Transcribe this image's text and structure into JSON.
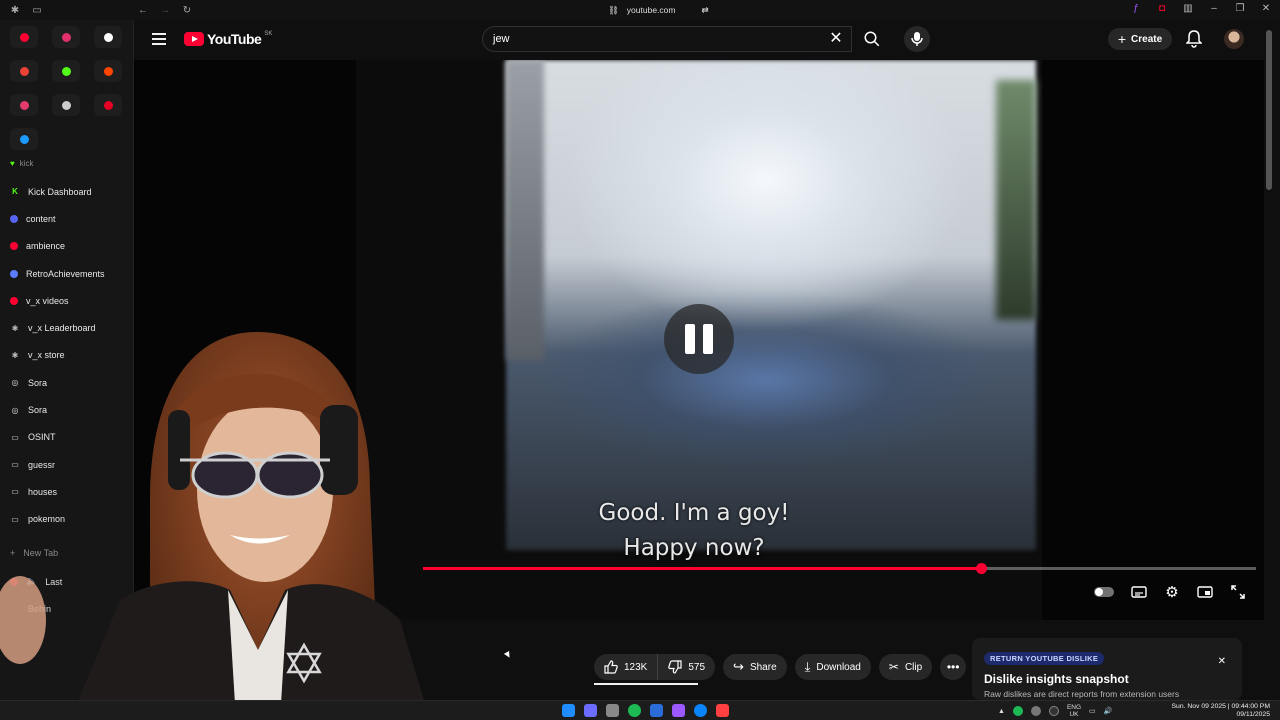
{
  "browser": {
    "url": "youtube.com"
  },
  "sidebar": {
    "pins": [
      {
        "name": "youtube",
        "color": "#ff0033"
      },
      {
        "name": "instagram",
        "color": "#e1306c"
      },
      {
        "name": "x",
        "color": "#ffffff"
      },
      {
        "name": "gmail",
        "color": "#ea4335"
      },
      {
        "name": "kick",
        "color": "#53fc18"
      },
      {
        "name": "reddit",
        "color": "#ff4500"
      },
      {
        "name": "calendar",
        "color": "#e33b6b"
      },
      {
        "name": "threads",
        "color": "#cccccc"
      },
      {
        "name": "pinterest",
        "color": "#e60023"
      },
      {
        "name": "steam",
        "color": "#1b9aff"
      }
    ],
    "section_label": "kick",
    "tabs": [
      {
        "label": "Kick Dashboard",
        "icon": "kick-icon",
        "color": "#53fc18"
      },
      {
        "label": "content",
        "icon": "discord-icon",
        "color": "#5865f2"
      },
      {
        "label": "ambience",
        "icon": "youtube-icon",
        "color": "#ff0033"
      },
      {
        "label": "RetroAchievements",
        "icon": "retro-icon",
        "color": "#5b7cff"
      },
      {
        "label": "v_x videos",
        "icon": "youtube-icon",
        "color": "#ff0033"
      },
      {
        "label": "v_x Leaderboard",
        "icon": "vx-icon",
        "color": "#bbbbbb"
      },
      {
        "label": "v_x store",
        "icon": "vx-icon",
        "color": "#bbbbbb"
      },
      {
        "label": "Sora",
        "icon": "sora-icon",
        "color": "#dddddd"
      },
      {
        "label": "Sora",
        "icon": "sora-icon",
        "color": "#dddddd"
      },
      {
        "label": "OSINT",
        "icon": "folder-icon",
        "color": "#dddddd"
      },
      {
        "label": "guessr",
        "icon": "folder-icon",
        "color": "#dddddd"
      },
      {
        "label": "houses",
        "icon": "folder-icon",
        "color": "#dddddd"
      },
      {
        "label": "pokemon",
        "icon": "folder-icon",
        "color": "#dddddd"
      }
    ],
    "new_tab": "New Tab",
    "extra_tabs": [
      "Last",
      "Behin"
    ]
  },
  "header": {
    "logo_text": "YouTube",
    "country_code": "SK",
    "search_value": "jew",
    "create_label": "Create"
  },
  "player": {
    "subtitle_line1": "Good. I'm a goy!",
    "subtitle_line2": "Happy now?",
    "progress_fraction": 0.67,
    "state": "paused"
  },
  "actions": {
    "likes": "123K",
    "dislikes": "575",
    "share": "Share",
    "download": "Download",
    "clip": "Clip"
  },
  "ryd": {
    "badge": "RETURN YOUTUBE DISLIKE",
    "title": "Dislike insights snapshot",
    "subtitle": "Raw dislikes are direct reports from extension users"
  },
  "taskbar": {
    "lang_top": "ENG",
    "lang_bottom": "UK",
    "clock_line1": "Sun. Nov 09 2025 | 09:44:00 PM",
    "clock_line2": "09/11/2025"
  },
  "colors": {
    "accent": "#ff0033",
    "background": "#0f0f0f",
    "pill": "#272727"
  }
}
